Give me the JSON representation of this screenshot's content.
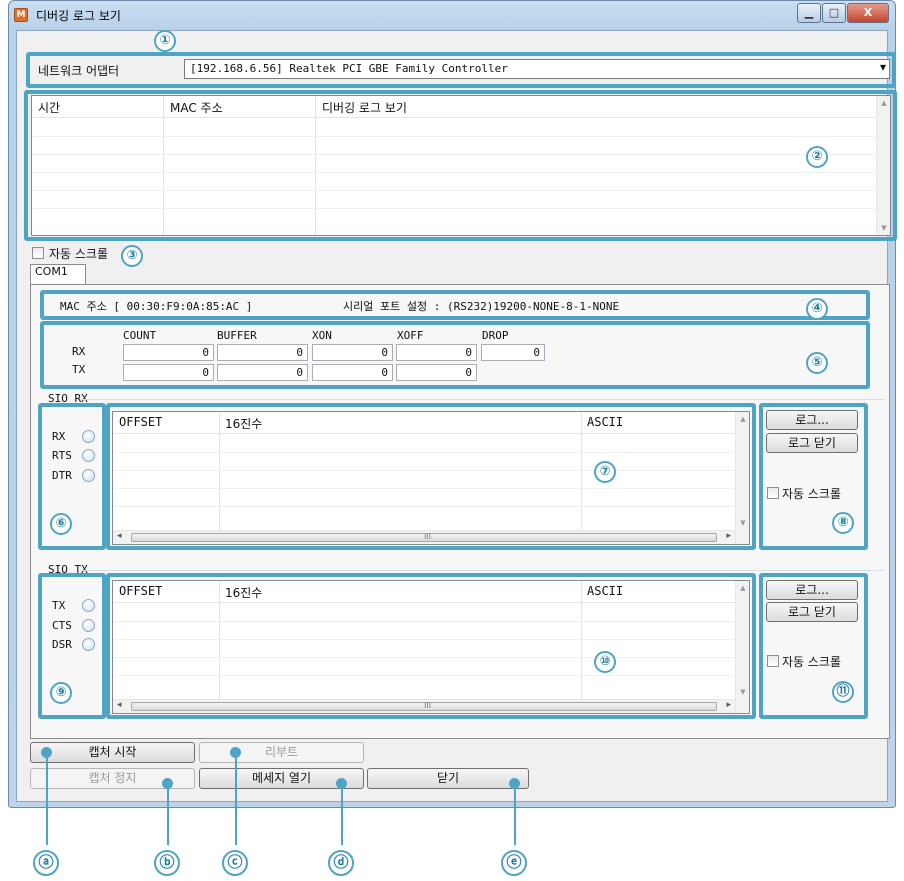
{
  "window": {
    "title": "디버깅 로그 보기",
    "app_icon_letter": "M",
    "minimize_glyph": "▁",
    "maximize_glyph": "□",
    "close_glyph": "X"
  },
  "adapter": {
    "label": "네트워크 어댑터",
    "selected": "[192.168.6.56] Realtek PCI GBE Family Controller",
    "dropdown_glyph": "▾"
  },
  "log_list": {
    "columns": [
      "시간",
      "MAC 주소",
      "디버깅 로그 보기"
    ]
  },
  "auto_scroll_label": "자동 스크롤",
  "tab": {
    "label": "COM1"
  },
  "info": {
    "mac": "MAC 주소 [ 00:30:F9:0A:85:AC ]",
    "serial": "시리얼 포트 설정 : (RS232)19200-NONE-8-1-NONE"
  },
  "counters": {
    "columns": [
      "COUNT",
      "BUFFER",
      "XON",
      "XOFF",
      "DROP"
    ],
    "rx_label": "RX",
    "tx_label": "TX",
    "rx": [
      "0",
      "0",
      "0",
      "0",
      "0"
    ],
    "tx": [
      "0",
      "0",
      "0",
      "0"
    ]
  },
  "sio_rx": {
    "group_label": "SIO RX",
    "signals": [
      "RX",
      "RTS",
      "DTR"
    ],
    "columns": [
      "OFFSET",
      "16진수",
      "ASCII"
    ],
    "log_button": "로그...",
    "close_log_button": "로그 닫기",
    "auto_scroll_label": "자동 스크롤"
  },
  "sio_tx": {
    "group_label": "SIO TX",
    "signals": [
      "TX",
      "CTS",
      "DSR"
    ],
    "columns": [
      "OFFSET",
      "16진수",
      "ASCII"
    ],
    "log_button": "로그...",
    "close_log_button": "로그 닫기",
    "auto_scroll_label": "자동 스크롤"
  },
  "buttons": {
    "capture_start": "캡처 시작",
    "reboot": "리부트",
    "capture_stop": "캡처 정지",
    "open_message": "메세지 열기",
    "close": "닫기"
  },
  "scroll_glyphs": {
    "up": "▲",
    "down": "▼",
    "left": "◂",
    "right": "▸",
    "grip": "III"
  },
  "callouts": {
    "numbers": [
      "①",
      "②",
      "③",
      "④",
      "⑤",
      "⑥",
      "⑦",
      "⑧",
      "⑨",
      "⑩",
      "⑪"
    ],
    "letters": [
      "ⓐ",
      "ⓑ",
      "ⓒ",
      "ⓓ",
      "ⓔ"
    ]
  },
  "colors": {
    "callout": "#4fa4c4",
    "window_frame": "#b7d1ea"
  }
}
